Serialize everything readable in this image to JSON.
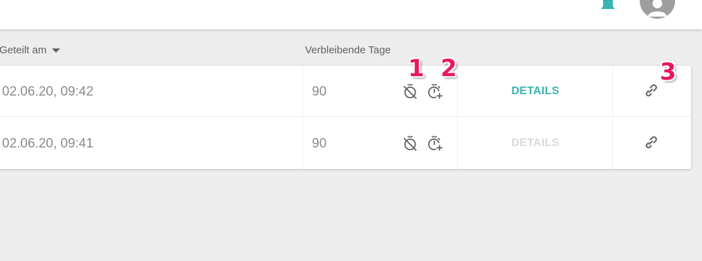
{
  "colors": {
    "accent": "#39b4b0",
    "disabled": "#d9d9d9",
    "annotation": "#e8185f",
    "avatar": "#9e9e9e"
  },
  "header": {
    "shared_on": "Geteilt am",
    "remaining_days": "Verbleibende Tage"
  },
  "rows": [
    {
      "date": "02.06.20, 09:42",
      "days": "90",
      "details": "DETAILS",
      "details_enabled": true
    },
    {
      "date": "02.06.20, 09:41",
      "days": "90",
      "details": "DETAILS",
      "details_enabled": false
    }
  ],
  "icons": {
    "timer_off": "timer-off-icon",
    "timer_add": "timer-add-icon",
    "link": "link-icon",
    "bell": "bell-icon",
    "avatar": "person-icon",
    "sort": "sort-down-icon"
  },
  "annotations": [
    "1",
    "2",
    "3"
  ]
}
